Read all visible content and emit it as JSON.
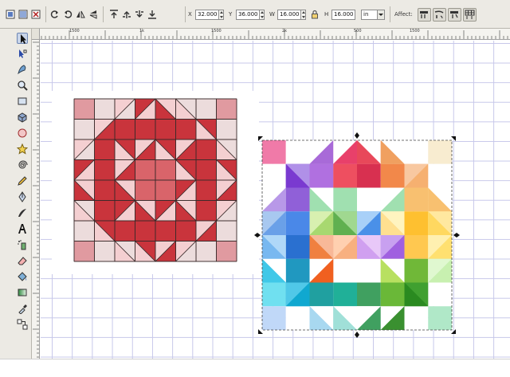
{
  "toolbar": {
    "x_label": "X",
    "x_value": "32.000",
    "y_label": "Y",
    "y_value": "36.000",
    "w_label": "W",
    "w_value": "16.000",
    "h_label": "H",
    "h_value": "16.000",
    "unit": "in",
    "affect_label": "Affect:"
  },
  "toolbar_icons": [
    "select-all-icon",
    "select-in-layers-icon",
    "deselect-icon",
    "rotate-ccw-icon",
    "rotate-cw-icon",
    "flip-horizontal-icon",
    "flip-vertical-icon",
    "raise-to-top-icon",
    "raise-icon",
    "lower-icon",
    "lower-to-bottom-icon",
    "lock-ratio-icon"
  ],
  "affect_icons": [
    "scale-stroke-icon",
    "scale-corners-icon",
    "move-gradients-icon",
    "move-patterns-icon"
  ],
  "tools": [
    "selector-tool",
    "node-tool",
    "tweak-tool",
    "zoom-tool",
    "rectangle-tool",
    "3d-box-tool",
    "ellipse-tool",
    "star-tool",
    "spiral-tool",
    "pencil-tool",
    "pen-tool",
    "calligraphy-tool",
    "text-tool",
    "spray-tool",
    "eraser-tool",
    "paint-bucket-tool",
    "gradient-tool",
    "dropper-tool",
    "connector-tool"
  ],
  "ruler_top_labels": [
    "1500",
    "1k",
    "1500",
    "2k",
    "500",
    "1500"
  ],
  "colors": {
    "chrome": "#eceae4",
    "grid": "#c7c8ea",
    "red_dark": "#c9343c",
    "red_mid": "#d9646a",
    "red_light": "#f4cfd1",
    "red_pale": "#ecdcdc",
    "red_pink": "#e09aa0"
  }
}
